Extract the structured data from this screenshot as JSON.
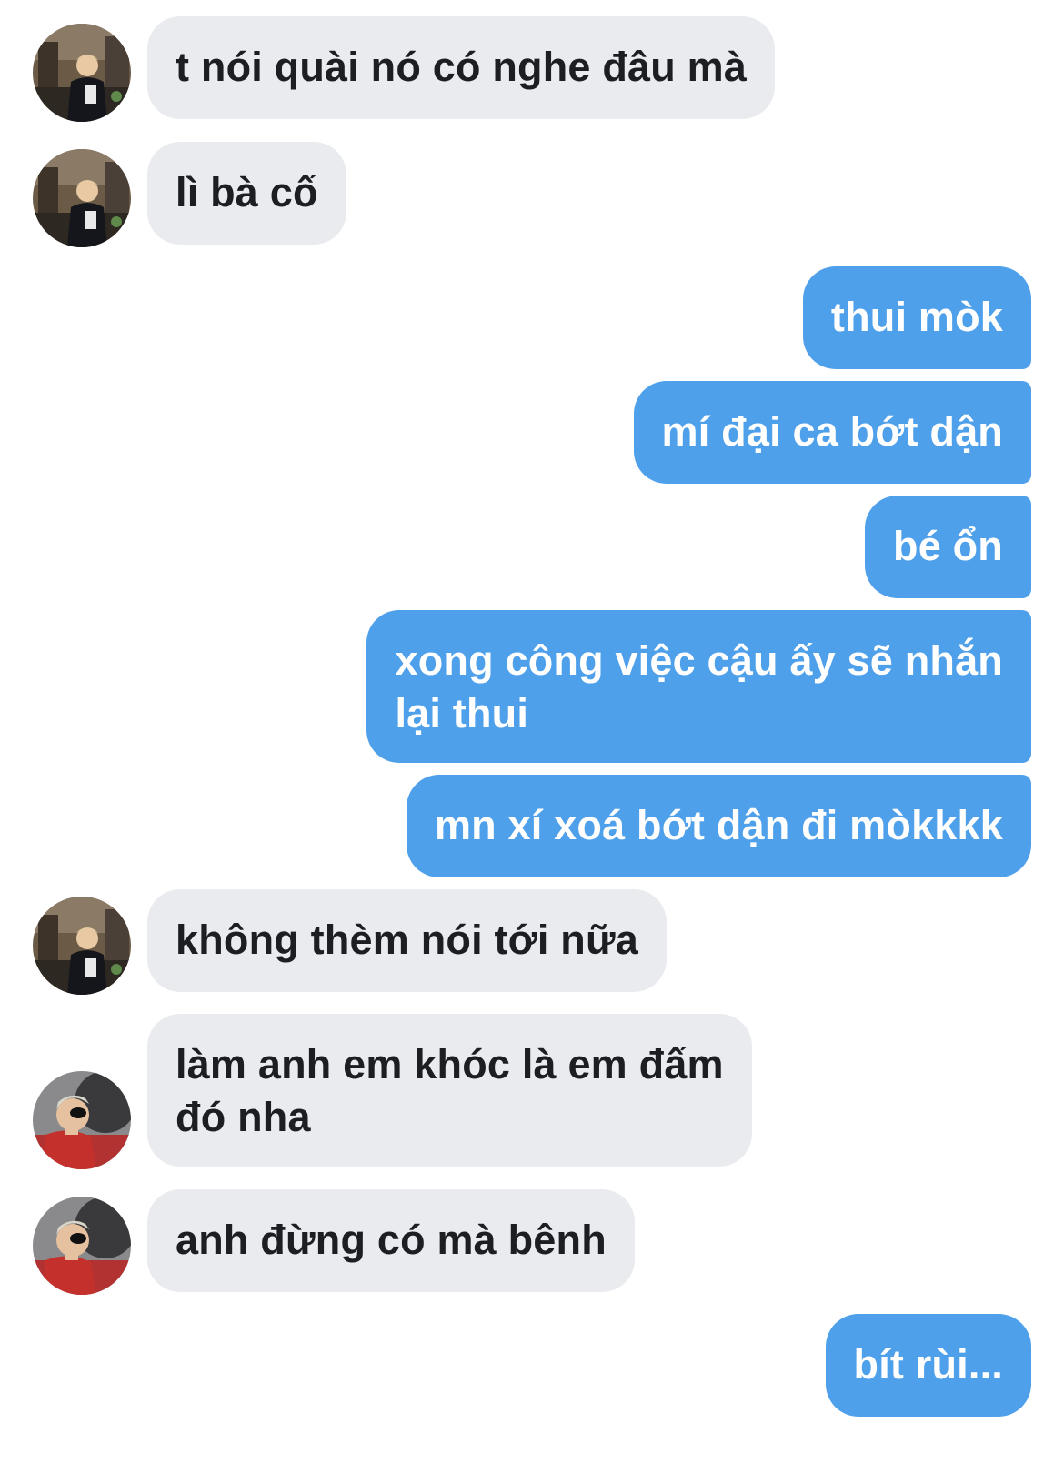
{
  "conversation": {
    "messages": [
      {
        "direction": "incoming",
        "sender": "user-a",
        "lines": [
          "t nói quài nó có nghe đâu mà"
        ]
      },
      {
        "direction": "incoming",
        "sender": "user-a",
        "lines": [
          "lì bà cố"
        ]
      },
      {
        "direction": "outgoing",
        "lines": [
          "thui mòk"
        ]
      },
      {
        "direction": "outgoing",
        "lines": [
          "mí đại ca bớt dận"
        ]
      },
      {
        "direction": "outgoing",
        "lines": [
          "bé ổn"
        ]
      },
      {
        "direction": "outgoing",
        "lines": [
          "xong công việc cậu ấy sẽ nhắn",
          "lại thui"
        ]
      },
      {
        "direction": "outgoing",
        "lines": [
          "mn xí xoá bớt dận đi mòkkkk"
        ]
      },
      {
        "direction": "incoming",
        "sender": "user-a",
        "lines": [
          "không thèm nói tới nữa"
        ]
      },
      {
        "direction": "incoming",
        "sender": "user-b",
        "lines": [
          "làm anh em khóc là em đấm",
          "đó nha"
        ]
      },
      {
        "direction": "incoming",
        "sender": "user-b",
        "lines": [
          "anh đừng có mà bênh"
        ]
      },
      {
        "direction": "outgoing",
        "lines": [
          "bít rùi..."
        ]
      }
    ]
  },
  "colors": {
    "background": "#ffffff",
    "incoming_bubble": "#e9ebee",
    "incoming_text": "#1c1e21",
    "outgoing_bubble": "#4fa0ea",
    "outgoing_text": "#ffffff"
  },
  "icons": {
    "user-a": "avatar-photo-icon",
    "user-b": "avatar-photo-icon"
  }
}
